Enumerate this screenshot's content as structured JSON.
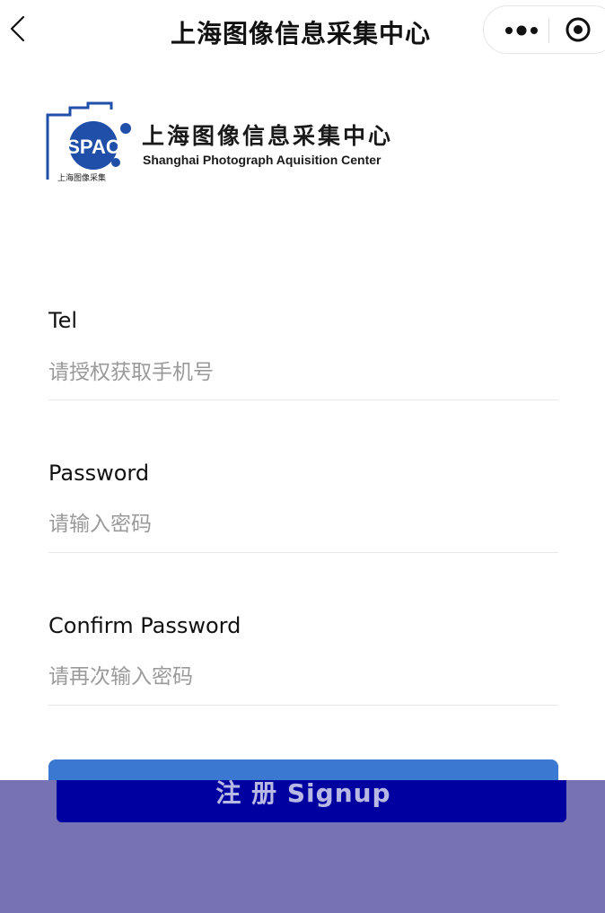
{
  "nav": {
    "title": "上海图像信息采集中心",
    "back_icon": "chevron-left-icon",
    "more_icon": "more-dots-icon",
    "close_icon": "target-close-icon"
  },
  "logo": {
    "mark_text": "SPAC",
    "mark_caption": "上海图像采集",
    "name_cn": "上海图像信息采集中心",
    "name_en": "Shanghai Photograph Aquisition Center",
    "accent_color": "#1f4fa8"
  },
  "form": {
    "tel": {
      "label": "Tel",
      "placeholder": "请授权获取手机号"
    },
    "password": {
      "label": "Password",
      "placeholder": "请输入密码"
    },
    "confirm_password": {
      "label": "Confirm Password",
      "placeholder": "请再次输入密码"
    }
  },
  "signup": {
    "label": "注 册 Signup",
    "button_color": "#3a78d2"
  },
  "overlay": {
    "background_color": "#7772b3",
    "bar_color": "#0000a0"
  }
}
